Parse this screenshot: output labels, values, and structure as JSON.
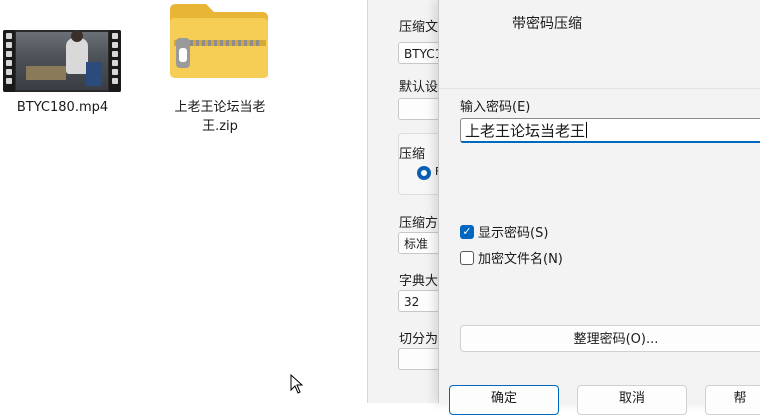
{
  "desktop": {
    "files": [
      {
        "name": "BTYC180.mp4",
        "icon": "video-file-icon"
      },
      {
        "name": "上老王论坛当老王.zip",
        "icon": "zip-folder-icon"
      }
    ]
  },
  "bg_dialog": {
    "compress_file_label": "压缩文",
    "compress_file_value": "BTYC1",
    "default_label": "默认设",
    "compress_group_label": "压缩",
    "radio_text": "F",
    "method_label": "压缩方",
    "method_value": "标准",
    "dict_label": "字典大",
    "dict_value": "32",
    "split_label": "切分为"
  },
  "dialog": {
    "title": "带密码压缩",
    "password_label": "输入密码(E)",
    "password_value": "上老王论坛当老王",
    "show_password_label": "显示密码(S)",
    "show_password_checked": true,
    "encrypt_names_label": "加密文件名(N)",
    "encrypt_names_checked": false,
    "manage_button": "整理密码(O)...",
    "ok_button": "确定",
    "cancel_button": "取消",
    "help_button": "帮"
  },
  "colors": {
    "accent": "#0067c0",
    "folder": "#f4c84a"
  }
}
